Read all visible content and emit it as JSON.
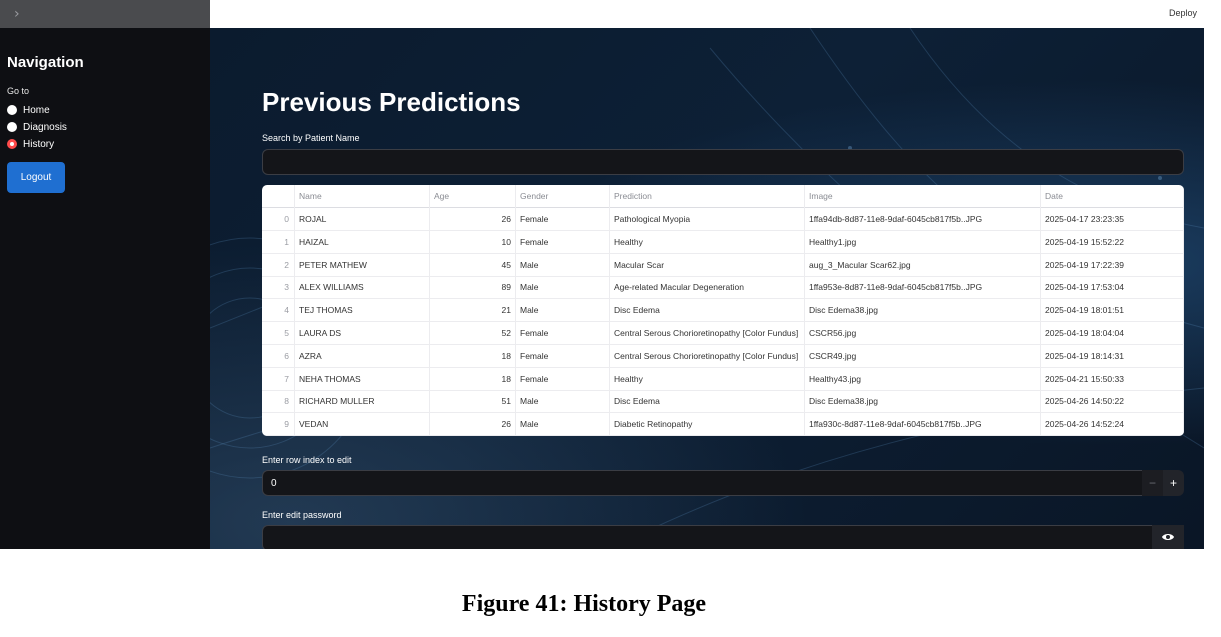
{
  "sidebar": {
    "toggle": "›",
    "title": "Navigation",
    "goto_label": "Go to",
    "items": [
      {
        "label": "Home",
        "selected": false
      },
      {
        "label": "Diagnosis",
        "selected": false
      },
      {
        "label": "History",
        "selected": true
      }
    ],
    "logout_label": "Logout"
  },
  "topbar": {
    "deploy_label": "Deploy"
  },
  "main": {
    "title": "Previous Predictions",
    "search_label": "Search by Patient Name",
    "search_value": "",
    "table": {
      "columns": [
        "",
        "Name",
        "Age",
        "Gender",
        "Prediction",
        "Image",
        "Date"
      ],
      "rows": [
        [
          "0",
          "ROJAL",
          "26",
          "Female",
          "Pathological Myopia",
          "1ffa94db-8d87-11e8-9daf-6045cb817f5b..JPG",
          "2025-04-17 23:23:35"
        ],
        [
          "1",
          "HAIZAL",
          "10",
          "Female",
          "Healthy",
          "Healthy1.jpg",
          "2025-04-19 15:52:22"
        ],
        [
          "2",
          "PETER MATHEW",
          "45",
          "Male",
          "Macular Scar",
          "aug_3_Macular Scar62.jpg",
          "2025-04-19 17:22:39"
        ],
        [
          "3",
          "ALEX WILLIAMS",
          "89",
          "Male",
          "Age-related Macular Degeneration",
          "1ffa953e-8d87-11e8-9daf-6045cb817f5b..JPG",
          "2025-04-19 17:53:04"
        ],
        [
          "4",
          "TEJ THOMAS",
          "21",
          "Male",
          "Disc Edema",
          "Disc Edema38.jpg",
          "2025-04-19 18:01:51"
        ],
        [
          "5",
          "LAURA DS",
          "52",
          "Female",
          "Central Serous Chorioretinopathy [Color Fundus]",
          "CSCR56.jpg",
          "2025-04-19 18:04:04"
        ],
        [
          "6",
          "AZRA",
          "18",
          "Female",
          "Central Serous Chorioretinopathy [Color Fundus]",
          "CSCR49.jpg",
          "2025-04-19 18:14:31"
        ],
        [
          "7",
          "NEHA  THOMAS",
          "18",
          "Female",
          "Healthy",
          "Healthy43.jpg",
          "2025-04-21 15:50:33"
        ],
        [
          "8",
          "RICHARD MULLER",
          "51",
          "Male",
          "Disc Edema",
          "Disc Edema38.jpg",
          "2025-04-26 14:50:22"
        ],
        [
          "9",
          "VEDAN",
          "26",
          "Male",
          "Diabetic Retinopathy",
          "1ffa930c-8d87-11e8-9daf-6045cb817f5b..JPG",
          "2025-04-26 14:52:24"
        ]
      ]
    },
    "row_index_label": "Enter row index to edit",
    "row_index_value": "0",
    "stepper_minus": "−",
    "stepper_plus": "+",
    "password_label": "Enter edit password",
    "password_value": ""
  },
  "caption": "Figure 41: History Page",
  "colors": {
    "accent": "#ff4b4b",
    "button": "#1f6fd1",
    "sidebar": "#0e0f13"
  }
}
